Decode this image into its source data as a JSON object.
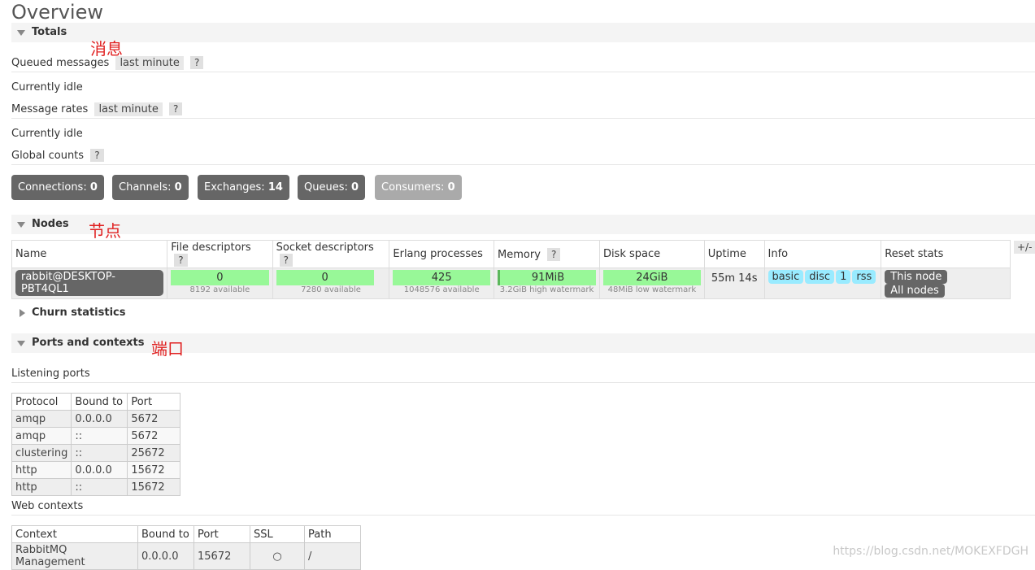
{
  "page_title": "Overview",
  "totals": {
    "title": "Totals",
    "annotation": "消息",
    "queued_label": "Queued messages",
    "queued_range": "last minute",
    "queued_help": "?",
    "queued_status": "Currently idle",
    "rates_label": "Message rates",
    "rates_range": "last minute",
    "rates_help": "?",
    "rates_status": "Currently idle",
    "global_label": "Global counts",
    "global_help": "?",
    "counts": [
      {
        "label": "Connections:",
        "value": "0"
      },
      {
        "label": "Channels:",
        "value": "0"
      },
      {
        "label": "Exchanges:",
        "value": "14"
      },
      {
        "label": "Queues:",
        "value": "0"
      },
      {
        "label": "Consumers:",
        "value": "0"
      }
    ]
  },
  "nodes": {
    "title": "Nodes",
    "annotation": "节点",
    "headers": {
      "name": "Name",
      "file": "File descriptors",
      "socket": "Socket descriptors",
      "erlang": "Erlang processes",
      "memory": "Memory",
      "disk": "Disk space",
      "uptime": "Uptime",
      "info": "Info",
      "reset": "Reset stats",
      "help": "?",
      "toggle": "+/-"
    },
    "row": {
      "name": "rabbit@DESKTOP-PBT4QL1",
      "file_value": "0",
      "file_sub": "8192 available",
      "socket_value": "0",
      "socket_sub": "7280 available",
      "erlang_value": "425",
      "erlang_sub": "1048576 available",
      "memory_value": "91MiB",
      "memory_fraction": 0.03,
      "memory_sub": "3.2GiB high watermark",
      "disk_value": "24GiB",
      "disk_sub": "48MiB low watermark",
      "uptime": "55m 14s",
      "info": [
        "basic",
        "disc",
        "1",
        "rss"
      ],
      "reset_this": "This node",
      "reset_all": "All nodes"
    }
  },
  "churn": {
    "title": "Churn statistics"
  },
  "ports": {
    "title": "Ports and contexts",
    "annotation": "端口",
    "listening_label": "Listening ports",
    "headers": [
      "Protocol",
      "Bound to",
      "Port"
    ],
    "rows": [
      [
        "amqp",
        "0.0.0.0",
        "5672"
      ],
      [
        "amqp",
        "::",
        "5672"
      ],
      [
        "clustering",
        "::",
        "25672"
      ],
      [
        "http",
        "0.0.0.0",
        "15672"
      ],
      [
        "http",
        "::",
        "15672"
      ]
    ],
    "web_label": "Web contexts",
    "web_headers": [
      "Context",
      "Bound to",
      "Port",
      "SSL",
      "Path"
    ],
    "web_rows": [
      [
        "RabbitMQ Management",
        "0.0.0.0",
        "15672",
        "○",
        "/"
      ]
    ]
  },
  "watermark": "https://blog.csdn.net/MOKEXFDGH"
}
